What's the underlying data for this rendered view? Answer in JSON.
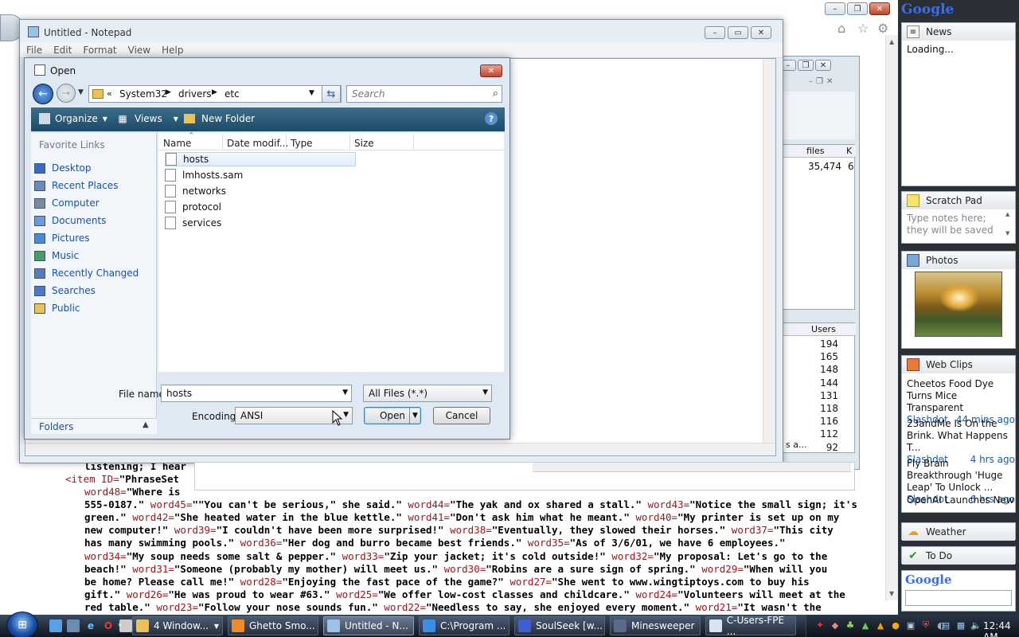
{
  "browser": {
    "xml_lines": [
      {
        "segments": [
          {
            "t": "listening; I hear ",
            "c": "text"
          }
        ]
      },
      {
        "segments": [
          {
            "t": "<item ID=",
            "c": "tag"
          },
          {
            "t": "\"PhraseSet",
            "c": "text"
          }
        ]
      },
      {
        "segments": [
          {
            "t": "word48=",
            "c": "attr"
          },
          {
            "t": "\"Where is",
            "c": "text"
          }
        ]
      },
      {
        "segments": [
          {
            "t": "555-0187.\" ",
            "c": "text"
          },
          {
            "t": "word45=",
            "c": "attr"
          },
          {
            "t": "\"\"You can't be serious,\" she said.\" ",
            "c": "text"
          },
          {
            "t": "word44=",
            "c": "attr"
          },
          {
            "t": "\"The yak and ox shared a stall.\" ",
            "c": "text"
          },
          {
            "t": "word43=",
            "c": "attr"
          },
          {
            "t": "\"Notice the small sign; it's",
            "c": "text"
          }
        ]
      },
      {
        "segments": [
          {
            "t": "green.\" ",
            "c": "text"
          },
          {
            "t": "word42=",
            "c": "attr"
          },
          {
            "t": "\"She heated water in the blue kettle.\" ",
            "c": "text"
          },
          {
            "t": "word41=",
            "c": "attr"
          },
          {
            "t": "\"Don't ask him what he meant.\" ",
            "c": "text"
          },
          {
            "t": "word40=",
            "c": "attr"
          },
          {
            "t": "\"My printer is set up on my",
            "c": "text"
          }
        ]
      },
      {
        "segments": [
          {
            "t": "new computer!\" ",
            "c": "text"
          },
          {
            "t": "word39=",
            "c": "attr"
          },
          {
            "t": "\"I couldn't have been more surprised!\" ",
            "c": "text"
          },
          {
            "t": "word38=",
            "c": "attr"
          },
          {
            "t": "\"Eventually, they slowed their horses.\" ",
            "c": "text"
          },
          {
            "t": "word37=",
            "c": "attr"
          },
          {
            "t": "\"This city",
            "c": "text"
          }
        ]
      },
      {
        "segments": [
          {
            "t": "has many swimming pools.\" ",
            "c": "text"
          },
          {
            "t": "word36=",
            "c": "attr"
          },
          {
            "t": "\"Her dog and burro became best friends.\" ",
            "c": "text"
          },
          {
            "t": "word35=",
            "c": "attr"
          },
          {
            "t": "\"As of 3/6/01, we have 6 employees.\"",
            "c": "text"
          }
        ]
      },
      {
        "segments": [
          {
            "t": "word34=",
            "c": "attr"
          },
          {
            "t": "\"My soup needs some salt & pepper.\" ",
            "c": "text"
          },
          {
            "t": "word33=",
            "c": "attr"
          },
          {
            "t": "\"Zip your jacket; it's cold outside!\" ",
            "c": "text"
          },
          {
            "t": "word32=",
            "c": "attr"
          },
          {
            "t": "\"My proposal: Let's go to the",
            "c": "text"
          }
        ]
      },
      {
        "segments": [
          {
            "t": "beach!\" ",
            "c": "text"
          },
          {
            "t": "word31=",
            "c": "attr"
          },
          {
            "t": "\"Someone (probably my mother) will meet us.\" ",
            "c": "text"
          },
          {
            "t": "word30=",
            "c": "attr"
          },
          {
            "t": "\"Robins are a sure sign of spring.\" ",
            "c": "text"
          },
          {
            "t": "word29=",
            "c": "attr"
          },
          {
            "t": "\"When will you",
            "c": "text"
          }
        ]
      },
      {
        "segments": [
          {
            "t": "be home? Please call me!\" ",
            "c": "text"
          },
          {
            "t": "word28=",
            "c": "attr"
          },
          {
            "t": "\"Enjoying the fast pace of the game?\" ",
            "c": "text"
          },
          {
            "t": "word27=",
            "c": "attr"
          },
          {
            "t": "\"She went to www.wingtiptoys.com to buy his",
            "c": "text"
          }
        ]
      },
      {
        "segments": [
          {
            "t": "gift.\" ",
            "c": "text"
          },
          {
            "t": "word26=",
            "c": "attr"
          },
          {
            "t": "\"He was proud to wear #63.\" ",
            "c": "text"
          },
          {
            "t": "word25=",
            "c": "attr"
          },
          {
            "t": "\"We offer low-cost classes and childcare.\" ",
            "c": "text"
          },
          {
            "t": "word24=",
            "c": "attr"
          },
          {
            "t": "\"Volunteers will meet at the",
            "c": "text"
          }
        ]
      },
      {
        "segments": [
          {
            "t": "red table.\" ",
            "c": "text"
          },
          {
            "t": "word23=",
            "c": "attr"
          },
          {
            "t": "\"Follow your nose sounds fun.\" ",
            "c": "text"
          },
          {
            "t": "word22=",
            "c": "attr"
          },
          {
            "t": "\"Needless to say, she enjoyed every moment.\" ",
            "c": "text"
          },
          {
            "t": "word21=",
            "c": "attr"
          },
          {
            "t": "\"It wasn't the",
            "c": "text"
          }
        ]
      }
    ]
  },
  "explorer": {
    "col_files": "files",
    "col_k": "K",
    "files_value": "35,474",
    "k_value": "6",
    "col_users": "Users",
    "users": [
      "194",
      "165",
      "148",
      "144",
      "131",
      "118",
      "116",
      "112",
      "92"
    ],
    "partial": "s a..."
  },
  "notepad": {
    "title": "Untitled - Notepad",
    "menu": [
      "File",
      "Edit",
      "Format",
      "View",
      "Help"
    ]
  },
  "dialog": {
    "title": "Open",
    "path": [
      "System32",
      "drivers",
      "etc"
    ],
    "search_placeholder": "Search",
    "toolbar": {
      "organize": "Organize",
      "views": "Views",
      "new_folder": "New Folder"
    },
    "favorite_links_label": "Favorite Links",
    "links": [
      "Desktop",
      "Recent Places",
      "Computer",
      "Documents",
      "Pictures",
      "Music",
      "Recently Changed",
      "Searches",
      "Public"
    ],
    "folders_label": "Folders",
    "columns": [
      "Name",
      "Date modif...",
      "Type",
      "Size"
    ],
    "files": [
      "hosts",
      "lmhosts.sam",
      "networks",
      "protocol",
      "services"
    ],
    "selected_file": "hosts",
    "file_name_label": "File name:",
    "file_name_value": "hosts",
    "file_type": "All Files  (*.*)",
    "encoding_label": "Encoding:",
    "encoding_value": "ANSI",
    "open_label": "Open",
    "cancel_label": "Cancel"
  },
  "sidebar": {
    "logo": "Google",
    "news": {
      "title": "News",
      "status": "Loading..."
    },
    "scratch": {
      "title": "Scratch Pad",
      "placeholder": "Type notes here; they will be saved"
    },
    "photos": {
      "title": "Photos"
    },
    "webclips": {
      "title": "Web Clips",
      "items": [
        {
          "headline": "Cheetos Food Dye Turns Mice Transparent",
          "source": "Slashdot",
          "time": "44 mins ago"
        },
        {
          "headline": "23andMe Is On the Brink. What Happens T...",
          "source": "Slashdot",
          "time": "4 hrs ago"
        },
        {
          "headline": "Fly Brain Breakthrough 'Huge Leap' To Unlock ...",
          "source": "Slashdot",
          "time": "6 hrs ago"
        },
        {
          "headline": "OpenAI Launches New",
          "source": "",
          "time": ""
        }
      ]
    },
    "weather": {
      "title": "Weather"
    },
    "todo": {
      "title": "To Do"
    },
    "search_logo": "Google"
  },
  "taskbar": {
    "tasks": [
      {
        "label": "4 Window...",
        "icon": "folder-icon",
        "color": "#e9c25b"
      },
      {
        "label": "Ghetto Smo...",
        "icon": "vlc-icon",
        "color": "#f08a24"
      },
      {
        "label": "Untitled - N...",
        "icon": "notepad-icon",
        "color": "#9cc3e6"
      },
      {
        "label": "C:\\Program ...",
        "icon": "ie-icon",
        "color": "#3a8ee6"
      },
      {
        "label": "SoulSeek [w...",
        "icon": "soulseek-icon",
        "color": "#3f5fd0"
      },
      {
        "label": "Minesweeper",
        "icon": "minesweeper-icon",
        "color": "#5a6a88"
      },
      {
        "label": "C-Users-FPE ...",
        "icon": "document-icon",
        "color": "#d8e4f0"
      }
    ],
    "clock": "12:44 AM"
  }
}
